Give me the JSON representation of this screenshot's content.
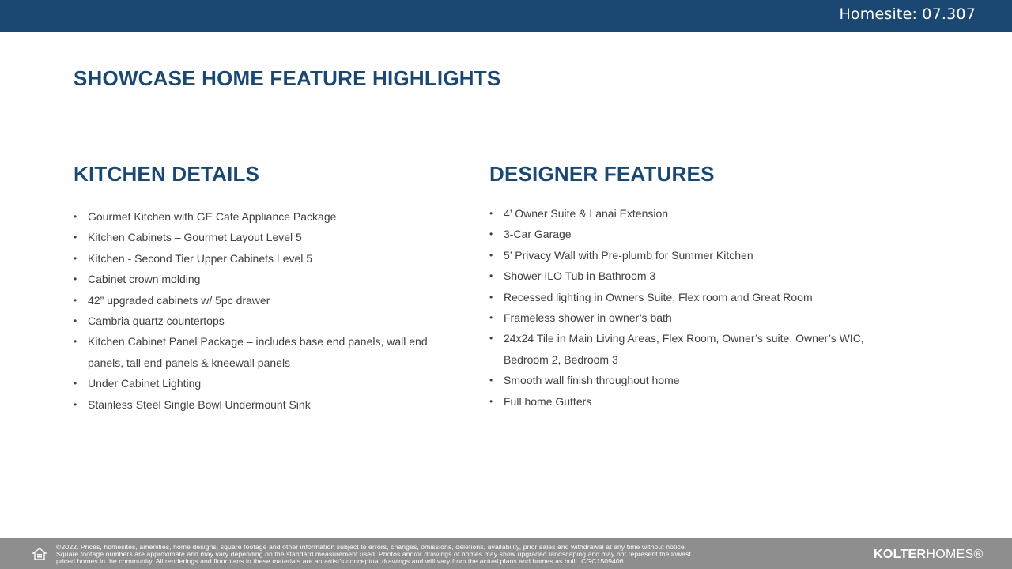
{
  "header": {
    "homesite": "Homesite: 07.307"
  },
  "page_title": "SHOWCASE HOME FEATURE HIGHLIGHTS",
  "kitchen": {
    "title": "KITCHEN DETAILS",
    "items": [
      "Gourmet Kitchen with GE Cafe Appliance Package",
      "Kitchen Cabinets – Gourmet Layout Level 5",
      "Kitchen - Second Tier Upper Cabinets Level 5",
      "Cabinet crown molding",
      "42” upgraded cabinets w/ 5pc drawer",
      "Cambria quartz countertops",
      "Kitchen Cabinet Panel Package – includes base end panels, wall end panels, tall end panels & kneewall panels",
      "Under Cabinet Lighting",
      "Stainless Steel Single Bowl Undermount Sink"
    ]
  },
  "designer": {
    "title": "DESIGNER FEATURES",
    "items": [
      "4’ Owner Suite & Lanai Extension",
      "3-Car Garage",
      "5’ Privacy Wall with Pre-plumb for Summer Kitchen",
      "Shower ILO Tub in Bathroom 3",
      "Recessed lighting in Owners Suite, Flex room and Great Room",
      "Frameless shower in owner’s bath",
      "24x24 Tile in Main Living Areas, Flex Room, Owner’s suite, Owner’s WIC, Bedroom 2, Bedroom 3",
      "Smooth wall finish throughout home",
      "Full home Gutters"
    ]
  },
  "footer": {
    "legal_line1": "©2022. Prices, homesites, amenities, home designs, square footage and other information subject to errors, changes, omissions, deletions, availability, prior sales and withdrawal at any time without notice.",
    "legal_line2": "Square footage numbers are approximate and may vary depending on the standard measurement used. Photos and/or drawings of homes may show upgraded landscaping and may not represent the lowest",
    "legal_line3": "priced homes in the community. All renderings and floorplans in these materials are an artist’s conceptual drawings and will vary from the actual plans and homes as built. CGC1509406",
    "logo_bold": "KOLTER",
    "logo_light": "HOMES®",
    "equal_housing_icon": "equal-housing-opportunity-icon"
  },
  "colors": {
    "brand_navy": "#1b4872",
    "footer_gray": "#8e8e8e",
    "body_text": "#404040"
  }
}
